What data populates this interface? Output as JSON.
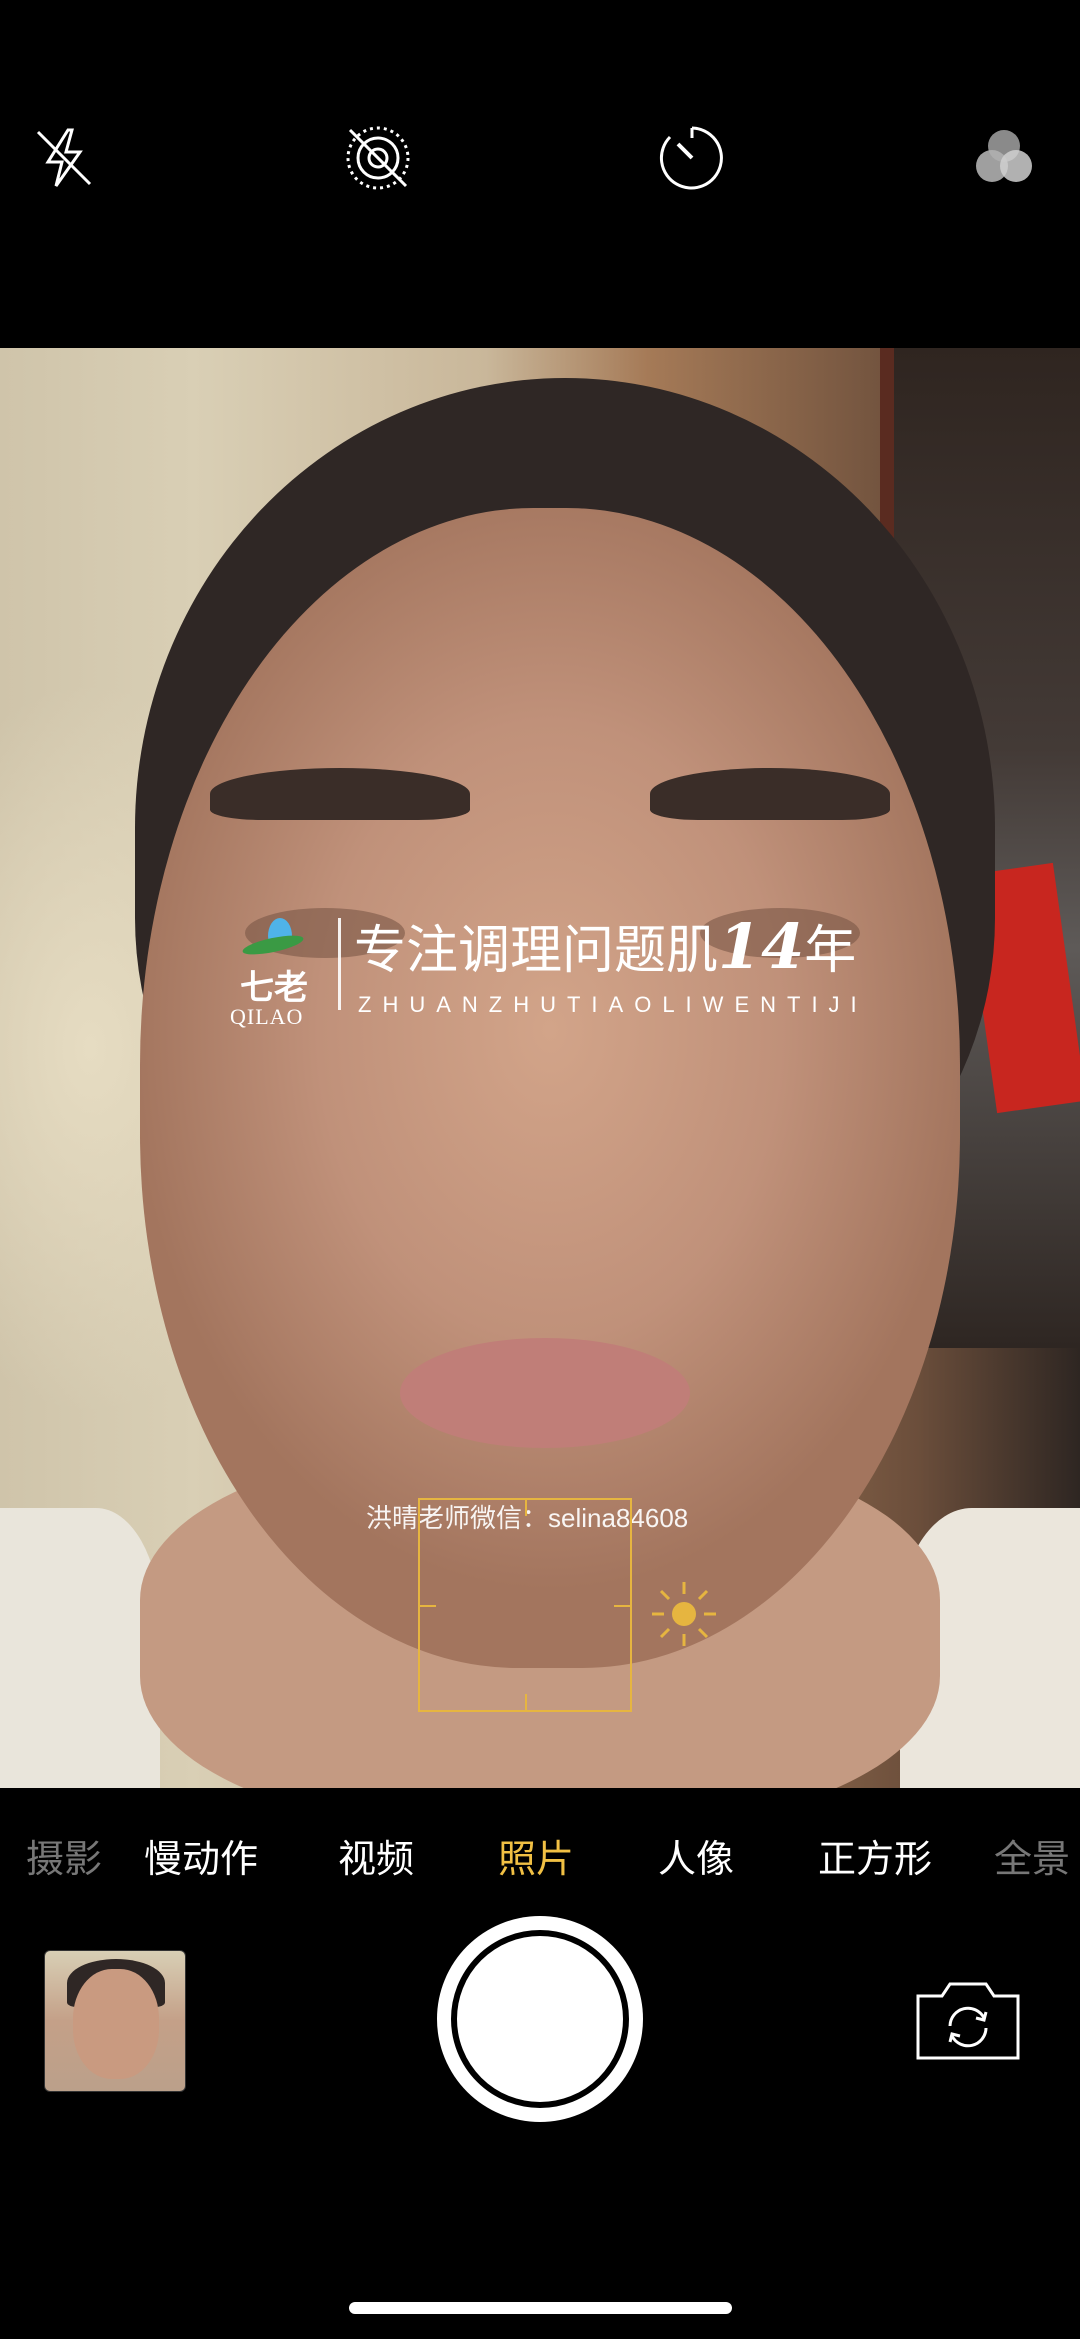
{
  "top_bar": {
    "icons": [
      "flash-off-icon",
      "live-photo-off-icon",
      "timer-icon",
      "filters-icon"
    ]
  },
  "watermark": {
    "logo_cn": "七老",
    "logo_en": "QILAO",
    "title_prefix": "专注调理问题肌",
    "title_number": "14",
    "title_suffix": "年",
    "subtitle": "ZHUANZHUTIAOLIWENTIJI",
    "contact": "洪晴老师微信：selina84608"
  },
  "modes": {
    "items": [
      {
        "label": "摄影",
        "state": "edge"
      },
      {
        "label": "慢动作",
        "state": "normal"
      },
      {
        "label": "视频",
        "state": "normal"
      },
      {
        "label": "照片",
        "state": "active"
      },
      {
        "label": "人像",
        "state": "normal"
      },
      {
        "label": "正方形",
        "state": "normal"
      },
      {
        "label": "全景",
        "state": "edge"
      }
    ]
  },
  "colors": {
    "accent": "#f1c044",
    "focus": "#e6b540",
    "background": "#000000"
  }
}
